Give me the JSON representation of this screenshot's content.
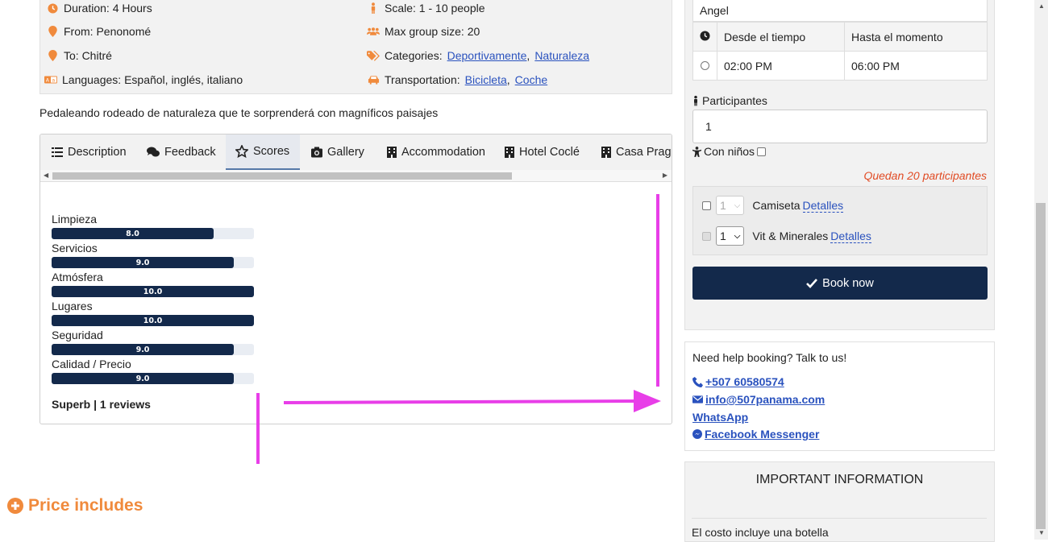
{
  "info": {
    "duration": "Duration: 4 Hours",
    "scale": "Scale: 1 - 10 people",
    "from": "From: Penonomé",
    "max_group": "Max group size: 20",
    "to": "To: Chitré",
    "categories_label": "Categories:",
    "categories": [
      "Deportivamente",
      "Naturaleza"
    ],
    "languages": "Languages: Español, inglés, italiano",
    "transport_label": "Transportation:",
    "transport": [
      "Bicicleta",
      "Coche"
    ]
  },
  "tagline": "Pedaleando rodeado de naturaleza que te sorprenderá con magníficos paisajes",
  "tabs": [
    {
      "label": "Description",
      "icon": "list-icon"
    },
    {
      "label": "Feedback",
      "icon": "comments-icon"
    },
    {
      "label": "Scores",
      "icon": "star-icon"
    },
    {
      "label": "Gallery",
      "icon": "camera-icon"
    },
    {
      "label": "Accommodation",
      "icon": "building-icon"
    },
    {
      "label": "Hotel Coclé",
      "icon": "building-icon"
    },
    {
      "label": "Casa Praga",
      "icon": "building-icon"
    }
  ],
  "scores": [
    {
      "label": "Limpieza",
      "value": "8.0",
      "fraction": 0.8
    },
    {
      "label": "Servicios",
      "value": "9.0",
      "fraction": 0.9
    },
    {
      "label": "Atmósfera",
      "value": "10.0",
      "fraction": 1.0
    },
    {
      "label": "Lugares",
      "value": "10.0",
      "fraction": 1.0
    },
    {
      "label": "Seguridad",
      "value": "9.0",
      "fraction": 0.9
    },
    {
      "label": "Calidad / Precio",
      "value": "9.0",
      "fraction": 0.9
    }
  ],
  "summary": "Superb | 1 reviews",
  "booking": {
    "guide_name": "Angel",
    "col_from": "Desde el tiempo",
    "col_to": "Hasta el momento",
    "slot_from": "02:00 PM",
    "slot_to": "06:00 PM",
    "participants_label": "Participantes",
    "participants_value": "1",
    "kids_label": "Con niños",
    "remaining": "Quedan 20 participantes",
    "extras": [
      {
        "qty": "1",
        "name": "Camiseta",
        "details": "Detalles"
      },
      {
        "qty": "1",
        "name": "Vit & Minerales",
        "details": "Detalles"
      }
    ],
    "book_label": "Book now"
  },
  "help": {
    "title": "Need help booking? Talk to us!",
    "phone": "+507 60580574",
    "email": "info@507panama.com",
    "whatsapp": "WhatsApp",
    "messenger": "Facebook Messenger"
  },
  "important": {
    "title": "IMPORTANT INFORMATION",
    "price_includes": "Price includes",
    "text": "El costo incluye una botella"
  },
  "colors": {
    "accent_orange": "#f08a3c",
    "navy": "#13294b",
    "link_blue": "#2a52be",
    "remaining_red": "#e14b24",
    "annotation_magenta": "#e83ee8"
  }
}
